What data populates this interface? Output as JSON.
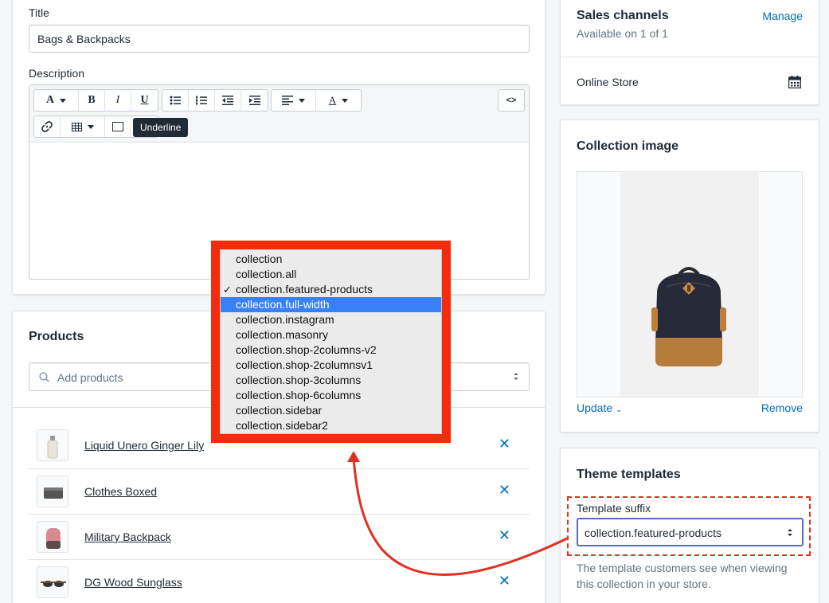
{
  "general": {
    "title_label": "Title",
    "title_value": "Bags & Backpacks",
    "description_label": "Description",
    "tooltip": "Underline",
    "toolbar": {
      "font_glyph": "A",
      "bold": "B",
      "italic": "I",
      "underline": "U",
      "color_glyph": "A",
      "html": "<>"
    }
  },
  "products": {
    "heading": "Products",
    "search_placeholder": "Add products",
    "items": [
      {
        "name": "Liquid Unero Ginger Lily"
      },
      {
        "name": "Clothes Boxed"
      },
      {
        "name": "Military Backpack"
      },
      {
        "name": "DG Wood Sunglass"
      }
    ],
    "remove_glyph": "✕"
  },
  "sales": {
    "heading": "Sales channels",
    "manage": "Manage",
    "available": "Available on 1 of 1",
    "channel": "Online Store"
  },
  "image": {
    "heading": "Collection image",
    "update": "Update",
    "remove": "Remove"
  },
  "theme": {
    "heading": "Theme templates",
    "suffix_label": "Template suffix",
    "suffix_value": "collection.featured-products",
    "help": "The template customers see when viewing this collection in your store."
  },
  "dropdown": {
    "options": [
      {
        "label": "collection"
      },
      {
        "label": "collection.all"
      },
      {
        "label": "collection.featured-products",
        "checked": "✓"
      },
      {
        "label": "collection.full-width"
      },
      {
        "label": "collection.instagram"
      },
      {
        "label": "collection.masonry"
      },
      {
        "label": "collection.shop-2columns-v2"
      },
      {
        "label": "collection.shop-2columnsv1"
      },
      {
        "label": "collection.shop-3columns"
      },
      {
        "label": "collection.shop-6columns"
      },
      {
        "label": "collection.sidebar"
      },
      {
        "label": "collection.sidebar2"
      }
    ],
    "highlighted_index": 3
  },
  "colors": {
    "accent": "#006fbb",
    "annotation": "#f32d0c",
    "highlight": "#3880f5"
  }
}
